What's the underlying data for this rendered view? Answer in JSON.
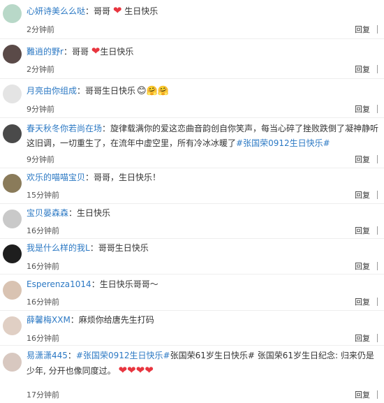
{
  "comments": [
    {
      "user": "心妍诗美么么哒",
      "text": "：哥哥",
      "hearts": 1,
      "after": " 生日快乐",
      "time": "2分钟前"
    },
    {
      "user": "難逍的野r",
      "text": "：哥哥",
      "hearts": 1,
      "after": "生日快乐",
      "time": "2分钟前"
    },
    {
      "user": "月亮由你组成",
      "text": "：哥哥生日快乐",
      "emoji": "😊🤗🤗",
      "time": "9分钟前"
    },
    {
      "user": "春天秋冬你若尚在场",
      "text": "：旋律载满你的爱这恋曲音韵创自你笑声，每当心碎了挫败跌倒了凝神静听这旧调，一切重生了，在流年中虚空里，所有冷冰冰暖了",
      "tag": "#张国荣0912生日快乐#",
      "time": "9分钟前"
    },
    {
      "user": "欢乐的喵喵宝贝",
      "text": "：哥哥，生日快乐！",
      "time": "15分钟前"
    },
    {
      "user": "宝贝晏森森",
      "text": "：生日快乐",
      "time": "16分钟前"
    },
    {
      "user": "我是什么样的我L",
      "text": "：哥哥生日快乐",
      "time": "16分钟前"
    },
    {
      "user": "Esperenza1014",
      "text": "：生日快乐哥哥～",
      "time": "16分钟前"
    },
    {
      "user": "薛馨梅XXM",
      "text": "：麻烦你给唐先生打码",
      "time": "16分钟前"
    },
    {
      "user": "易潇潇445",
      "text": "：",
      "tag": "#张国荣0912生日快乐#",
      "after": "张国荣61岁生日快乐# 张国荣61岁生日纪念: 归来仍是少年, 分开也像同度过。",
      "hearts": 4,
      "time": "17分钟前"
    }
  ],
  "reply_label": "回复",
  "heart_glyph": "❤",
  "colors": {
    "link": "#2c79c4",
    "heart": "#e8353f"
  }
}
